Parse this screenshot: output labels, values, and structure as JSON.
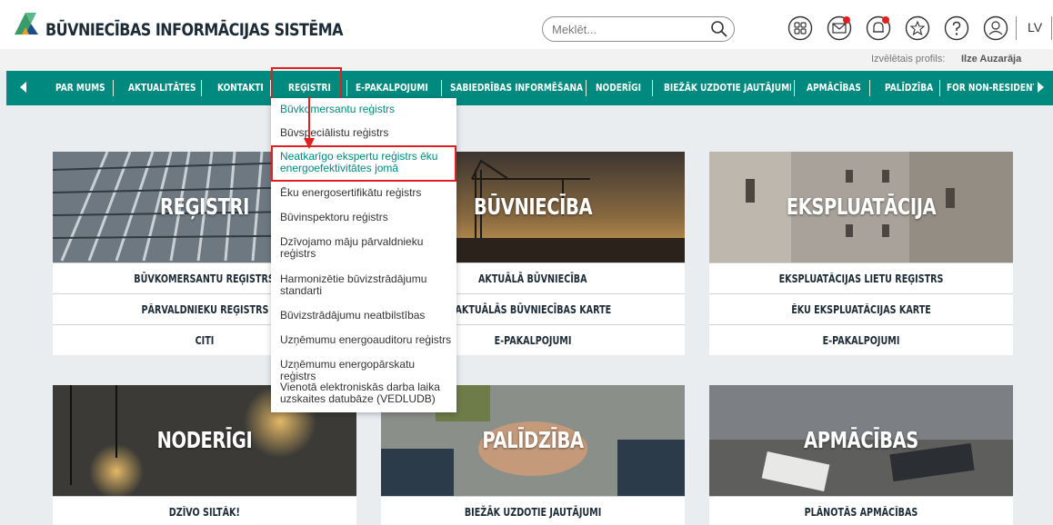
{
  "header": {
    "title": "BŪVNIECĪBAS INFORMĀCIJAS SISTĒMA",
    "search_placeholder": "Meklēt...",
    "lang": "LV",
    "icons": [
      "apps-icon",
      "mail-icon",
      "bell-icon",
      "star-icon",
      "help-icon",
      "user-icon"
    ]
  },
  "profile": {
    "label": "Izvēlētais profils:",
    "name": "Ilze Auzarāja"
  },
  "nav": {
    "items": [
      "PAR MUMS",
      "AKTUALITĀTES",
      "KONTAKTI",
      "REĢISTRI",
      "E-PAKALPOJUMI",
      "SABIEDRĪBAS INFORMĒŠANA",
      "NODERĪGI",
      "BIEŽĀK UZDOTIE JAUTĀJUMI",
      "APMĀCĪBAS",
      "PALĪDZĪBA",
      "FOR NON-RESIDENTS"
    ]
  },
  "dropdown": {
    "items": [
      "Būvkomersantu reģistrs",
      "Būvspeciālistu reģistrs",
      "Neatkarīgo ekspertu reģistrs ēku energoefektivitātes jomā",
      "Ēku energosertifikātu reģistrs",
      "Būvinspektoru reģistrs",
      "Dzīvojamo māju pārvaldnieku reģistrs",
      "Harmonizētie būvizstrādājumu standarti",
      "Būvizstrādājumu neatbilstības",
      "Uzņēmumu energoauditoru reģistrs",
      "Uzņēmumu energopārskatu reģistrs",
      "Vienotā elektroniskās darba laika uzskaites datubāze (VEDLUDB)"
    ]
  },
  "tiles": {
    "registri": {
      "title": "REĢISTRI",
      "links": [
        "BŪVKOMERSANTU REĢISTRS",
        "PĀRVALDNIEKU REĢISTRS",
        "CITI"
      ]
    },
    "buvnieciba": {
      "title": "BŪVNIECĪBA",
      "links": [
        "AKTUĀLĀ BŪVNIECĪBA",
        "AKTUĀLĀS BŪVNIECĪBAS KARTE",
        "E-PAKALPOJUMI"
      ]
    },
    "ekspluatacija": {
      "title": "EKSPLUATĀCIJA",
      "links": [
        "EKSPLUATĀCIJAS LIETU REĢISTRS",
        "ĒKU EKSPLUATĀCIJAS KARTE",
        "E-PAKALPOJUMI"
      ]
    },
    "noderigi": {
      "title": "NODERĪGI",
      "links": [
        "DZĪVO SILTĀK!"
      ]
    },
    "palidziba": {
      "title": "PALĪDZĪBA",
      "links": [
        "BIEŽĀK UZDOTIE JAUTĀJUMI"
      ]
    },
    "apmacibas": {
      "title": "APMĀCĪBAS",
      "links": [
        "PLĀNOTĀS APMĀCĪBAS"
      ]
    }
  },
  "colors": {
    "accent": "#00897f",
    "highlight": "#e02020",
    "title_text": "#1c2b36"
  }
}
